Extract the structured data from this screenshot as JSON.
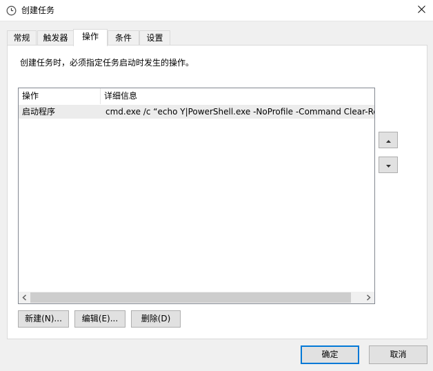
{
  "window": {
    "title": "创建任务",
    "close_glyph": "✕"
  },
  "tabs": [
    {
      "label": "常规",
      "active": false
    },
    {
      "label": "触发器",
      "active": false
    },
    {
      "label": "操作",
      "active": true
    },
    {
      "label": "条件",
      "active": false
    },
    {
      "label": "设置",
      "active": false
    }
  ],
  "panel": {
    "description": "创建任务时，必须指定任务启动时发生的操作。"
  },
  "table": {
    "columns": [
      "操作",
      "详细信息"
    ],
    "rows": [
      {
        "action": "启动程序",
        "details": "cmd.exe /c  “echo Y|PowerShell.exe -NoProfile -Command Clear-Re"
      }
    ]
  },
  "buttons": {
    "new": "新建(N)...",
    "edit": "编辑(E)...",
    "delete": "删除(D)",
    "ok": "确定",
    "cancel": "取消"
  },
  "icons": {
    "title": "clock-icon",
    "move_up": "up-arrow-icon",
    "move_down": "down-arrow-icon",
    "scroll_left": "chevron-left-icon",
    "scroll_right": "chevron-right-icon"
  },
  "colors": {
    "accent": "#0078d7",
    "selected_row": "#ececec"
  }
}
